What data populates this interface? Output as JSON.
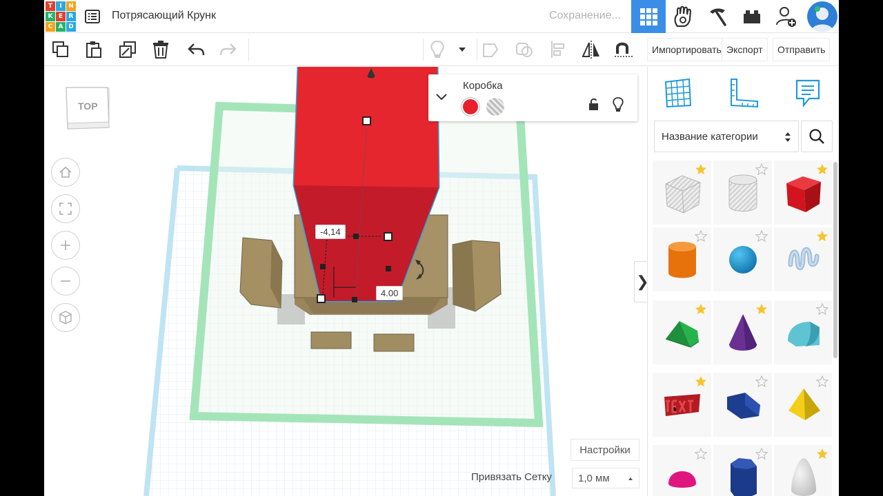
{
  "header": {
    "logo_letters": [
      "TIN",
      "KER",
      "CAD"
    ],
    "logo_colors": [
      "#e0402d",
      "#29a9e0",
      "#f7a11a",
      "#28b06a",
      "#e0402d",
      "#29a9e0",
      "#f7a11a",
      "#28b06a",
      "#29a9e0"
    ],
    "doc_title": "Потрясающий Крунк",
    "save_status": "Сохранение...",
    "accent": "#3b8ee8",
    "icons": [
      "3d-design-icon",
      "circuits-icon",
      "codeblocks-icon",
      "lesson-plans-icon",
      "add-user-icon",
      "user-avatar"
    ]
  },
  "toolbar": {
    "import_label": "Импортировать",
    "export_label": "Экспорт",
    "send_label": "Отправить",
    "icons": [
      "copy-icon",
      "paste-icon",
      "duplicate-icon",
      "delete-icon",
      "undo-icon",
      "redo-icon",
      "light-icon",
      "group-icon",
      "ungroup-icon",
      "align-icon",
      "mirror-icon",
      "workplane-magnet-icon"
    ]
  },
  "viewcube": {
    "label": "TOP"
  },
  "inspector": {
    "title": "Коробка",
    "solid_color": "#e8202b",
    "hole_label": "hole-swatch"
  },
  "dimensions": {
    "left_value": "-4,14",
    "right_value": "4.00"
  },
  "workplane": {
    "settings_label": "Настройки",
    "snap_label": "Привязать Сетку",
    "snap_value": "1,0 мм"
  },
  "library": {
    "category_placeholder": "Название категории",
    "shapes": [
      {
        "name": "box-hole",
        "starred": true
      },
      {
        "name": "cylinder-hole",
        "starred": false
      },
      {
        "name": "box",
        "starred": true
      },
      {
        "name": "cylinder",
        "starred": false
      },
      {
        "name": "sphere",
        "starred": false
      },
      {
        "name": "scribble",
        "starred": true
      },
      {
        "name": "roof",
        "starred": true
      },
      {
        "name": "cone",
        "starred": true
      },
      {
        "name": "round-roof",
        "starred": false
      },
      {
        "name": "text",
        "starred": true
      },
      {
        "name": "wedge",
        "starred": false
      },
      {
        "name": "pyramid",
        "starred": false
      },
      {
        "name": "half-sphere",
        "starred": false
      },
      {
        "name": "polygon",
        "starred": false
      },
      {
        "name": "paraboloid",
        "starred": true
      }
    ]
  }
}
